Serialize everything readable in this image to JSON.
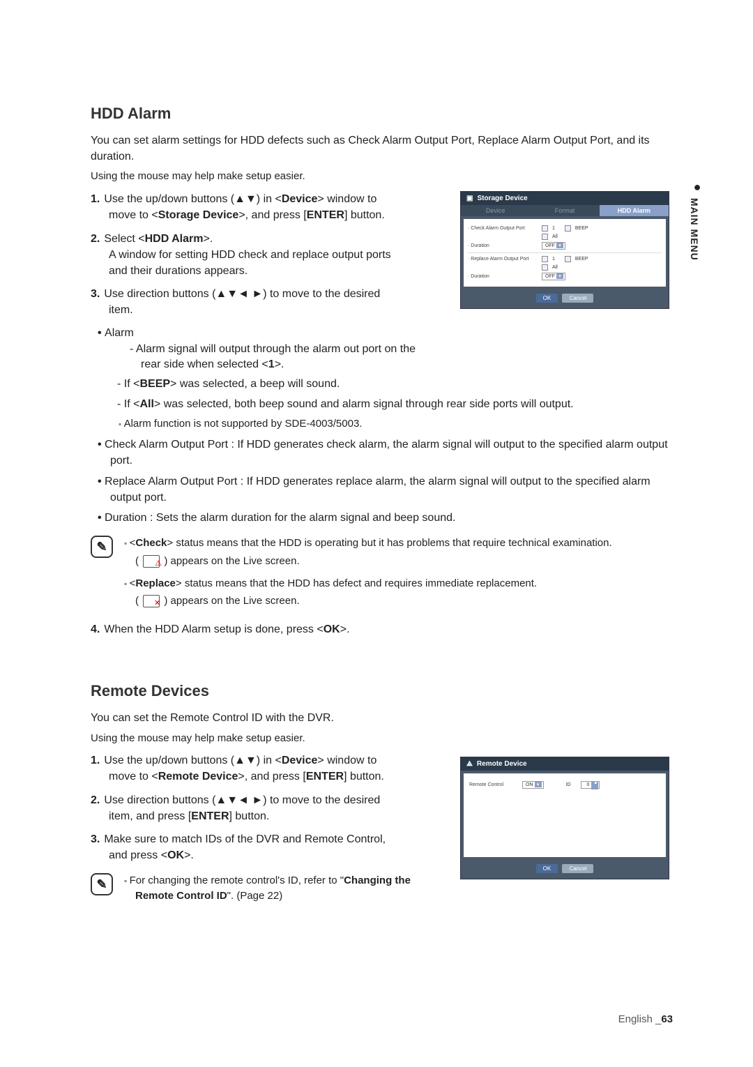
{
  "sideTab": "MAIN MENU",
  "hdd": {
    "title": "HDD Alarm",
    "intro": "You can set alarm settings for HDD defects such as Check Alarm Output Port, Replace Alarm Output Port, and its duration.",
    "mouse": "Using the mouse may help make setup easier.",
    "step1_a": "Use the up/down buttons (▲▼) in <",
    "step1_b": "Device",
    "step1_c": "> window to move to <",
    "step1_d": "Storage Device",
    "step1_e": ">, and press [",
    "step1_f": "ENTER",
    "step1_g": "] button.",
    "step2_a": "Select <",
    "step2_b": "HDD Alarm",
    "step2_c": ">.",
    "step2_line2": "A window for setting HDD check and replace output ports and their durations appears.",
    "step3": "Use direction buttons (▲▼◄ ►) to move to the desired item.",
    "alarm_h": "Alarm",
    "alarm_d1_a": "Alarm signal will output through the alarm out port on the rear side when selected <",
    "alarm_d1_b": "1",
    "alarm_d1_c": ">.",
    "alarm_d2_a": "If <",
    "alarm_d2_b": "BEEP",
    "alarm_d2_c": "> was selected, a beep will sound.",
    "alarm_d3_a": "If <",
    "alarm_d3_b": "All",
    "alarm_d3_c": "> was selected, both beep sound and alarm signal through rear side ports will output.",
    "alarm_note": "Alarm function is not supported by SDE-4003/5003.",
    "b_check": "Check Alarm Output Port : If HDD generates check alarm, the alarm signal will output to the specified alarm output port.",
    "b_replace": "Replace Alarm Output Port : If HDD generates replace alarm, the alarm signal will output to the specified alarm output port.",
    "b_duration": "Duration : Sets the alarm duration for the alarm signal and beep sound.",
    "note_check_a": "<",
    "note_check_b": "Check",
    "note_check_c": "> status means that the HDD is operating but it has problems that require technical examination.",
    "note_check_sub": "(  ) appears on the Live screen.",
    "note_replace_a": "<",
    "note_replace_b": "Replace",
    "note_replace_c": "> status means that the HDD has defect and requires immediate replacement.",
    "note_replace_sub": "(  ) appears on the Live screen.",
    "step4_a": "When the HDD Alarm setup is done, press <",
    "step4_b": "OK",
    "step4_c": ">."
  },
  "dlg1": {
    "title": "Storage Device",
    "tab1": "Device",
    "tab2": "Format",
    "tab3": "HDD Alarm",
    "l_check": "· Check Alarm Output Port",
    "opt1": "1",
    "optAll": "All",
    "optBeep": "BEEP",
    "l_dur": "· Duration",
    "sel_off": "OFF",
    "l_replace": "· Replace Alarm Output Port",
    "btn_ok": "OK",
    "btn_cancel": "Cancel"
  },
  "remote": {
    "title": "Remote Devices",
    "intro": "You can set the Remote Control ID with the DVR.",
    "mouse": "Using the mouse may help make setup easier.",
    "step1_a": "Use the up/down buttons (▲▼) in <",
    "step1_b": "Device",
    "step1_c": "> window to move to <",
    "step1_d": "Remote Device",
    "step1_e": ">, and press [",
    "step1_f": "ENTER",
    "step1_g": "] button.",
    "step2_a": "Use direction buttons (▲▼◄ ►) to move to the desired item, and press [",
    "step2_b": "ENTER",
    "step2_c": "] button.",
    "step3_a": "Make sure to match IDs of the DVR and Remote Control, and press <",
    "step3_b": "OK",
    "step3_c": ">.",
    "note_a": "For changing the remote control's ID, refer to \"",
    "note_b": "Changing the Remote Control ID",
    "note_c": "\". (Page 22)"
  },
  "dlg2": {
    "title": "Remote Device",
    "l_rc": "Remote Control",
    "sel_on": "ON",
    "l_id": "ID",
    "id_val": "0",
    "btn_ok": "OK",
    "btn_cancel": "Cancel"
  },
  "footer": {
    "lang": "English _",
    "page": "63"
  }
}
